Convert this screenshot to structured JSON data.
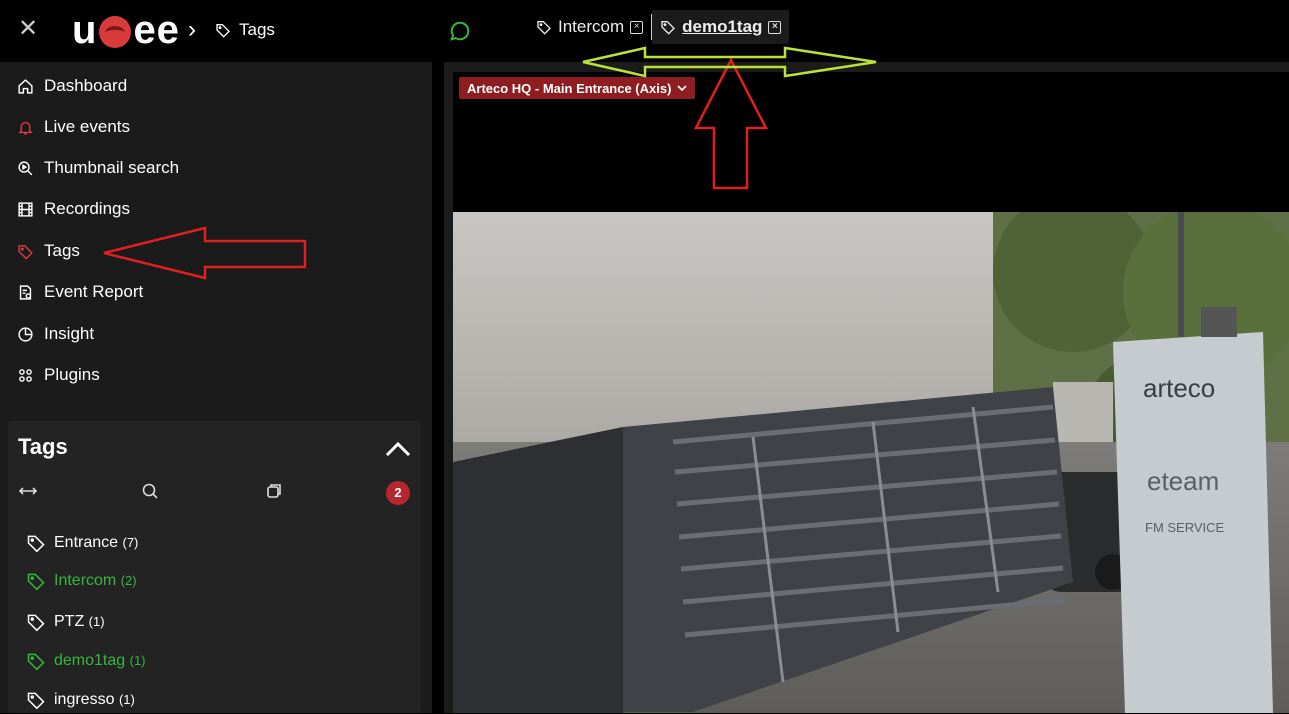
{
  "header": {
    "logo": "usee",
    "breadcrumb": "Tags",
    "tabs": [
      {
        "label": "Intercom"
      },
      {
        "label": "demo1tag",
        "active": true
      }
    ]
  },
  "nav": [
    {
      "label": "Dashboard",
      "icon": "home-icon"
    },
    {
      "label": "Live events",
      "icon": "bell-icon"
    },
    {
      "label": "Thumbnail search",
      "icon": "thumbnail-search-icon"
    },
    {
      "label": "Recordings",
      "icon": "film-icon"
    },
    {
      "label": "Tags",
      "icon": "tag-icon"
    },
    {
      "label": "Event Report",
      "icon": "report-icon"
    },
    {
      "label": "Insight",
      "icon": "pie-chart-icon"
    },
    {
      "label": "Plugins",
      "icon": "plugins-icon"
    }
  ],
  "tags_panel": {
    "title": "Tags",
    "badge": "2",
    "items": [
      {
        "name": "Entrance",
        "count": "(7)"
      },
      {
        "name": "Intercom",
        "count": "(2)"
      },
      {
        "name": "PTZ",
        "count": "(1)"
      },
      {
        "name": "demo1tag",
        "count": "(1)"
      },
      {
        "name": "ingresso",
        "count": "(1)"
      }
    ]
  },
  "camera": {
    "label": "Arteco HQ - Main Entrance (Axis)"
  },
  "scene": {
    "sign_brand": "arteco",
    "sign_team": "eteam",
    "sign_service": "FM SERVICE"
  },
  "colors": {
    "accent_red": "#d93b3b",
    "active_green": "#35b83b",
    "badge_red": "#b5272d",
    "annotation_red": "#e0201f",
    "annotation_green": "#b9e23a"
  }
}
